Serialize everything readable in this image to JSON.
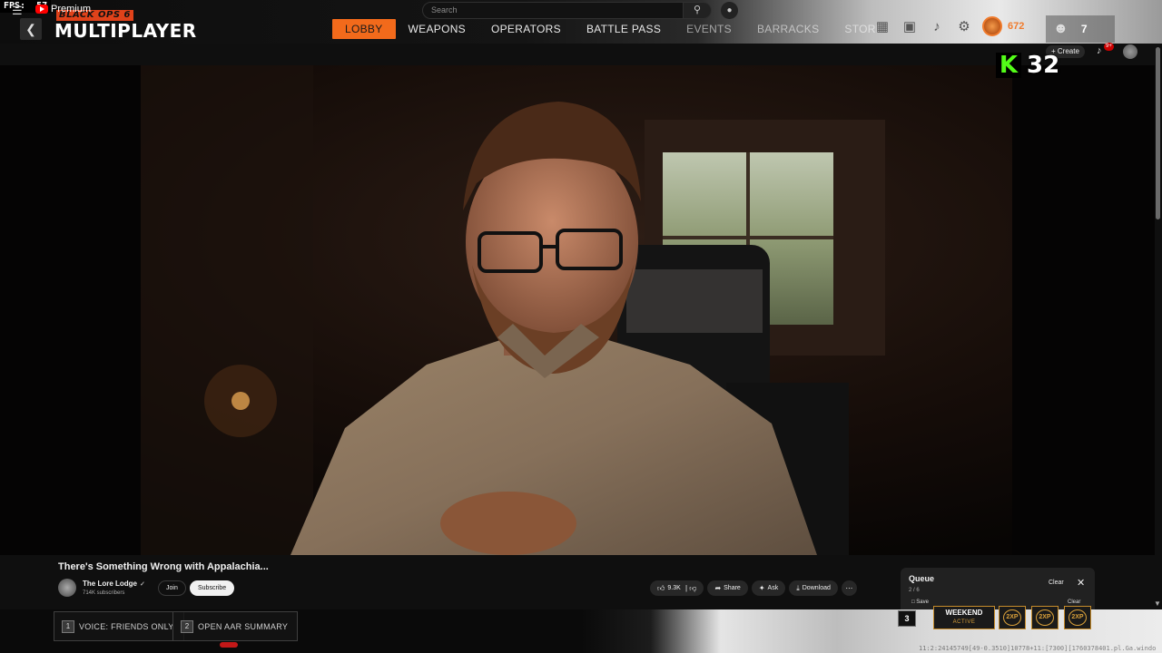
{
  "hud": {
    "fps_label": "FPS:",
    "fps_value": "57"
  },
  "game": {
    "subtitle": "BLACK OPS 6",
    "title": "MULTIPLAYER",
    "tabs": [
      {
        "label": "LOBBY",
        "active": true
      },
      {
        "label": "WEAPONS"
      },
      {
        "label": "OPERATORS"
      },
      {
        "label": "BATTLE PASS"
      },
      {
        "label": "EVENTS"
      },
      {
        "label": "BARRACKS"
      },
      {
        "label": "STORE"
      }
    ],
    "top_icons": [
      "grid-icon",
      "camera-icon",
      "bell-icon",
      "gear-icon"
    ],
    "currency": "672",
    "party_count": "7"
  },
  "youtube": {
    "logo_text": "Premium",
    "search_placeholder": "Search",
    "create_label": "Create",
    "notification_count": "9+",
    "video": {
      "title": "There's Something Wrong with Appalachia...",
      "channel": "The Lore Lodge",
      "subscribers": "714K subscribers",
      "join_label": "Join",
      "subscribe_label": "Subscribe",
      "likes": "9.3K",
      "share_label": "Share",
      "ask_label": "Ask",
      "download_label": "Download"
    },
    "queue": {
      "title": "Queue",
      "position": "2 / 6",
      "clear_label": "Clear",
      "save_label": "Save",
      "clear2_label": "Clear"
    }
  },
  "stream": {
    "viewer_count": "32"
  },
  "footer": {
    "hints": [
      {
        "key": "1",
        "label": "VOICE: FRIENDS ONLY"
      },
      {
        "key": "2",
        "label": "OPEN AAR SUMMARY"
      }
    ],
    "key3": "3",
    "weekend_title": "WEEKEND",
    "weekend_status": "ACTIVE",
    "xp_badges": [
      "2XP",
      "2XP",
      "2XP"
    ],
    "debug_text": "11:2:24145749[49-0.3510]10778+11:[7300][1760378401.pl.Ga.windo"
  },
  "colors": {
    "accent": "#f26a1b",
    "kick_green": "#53fc18",
    "yt_red": "#ff0000"
  }
}
